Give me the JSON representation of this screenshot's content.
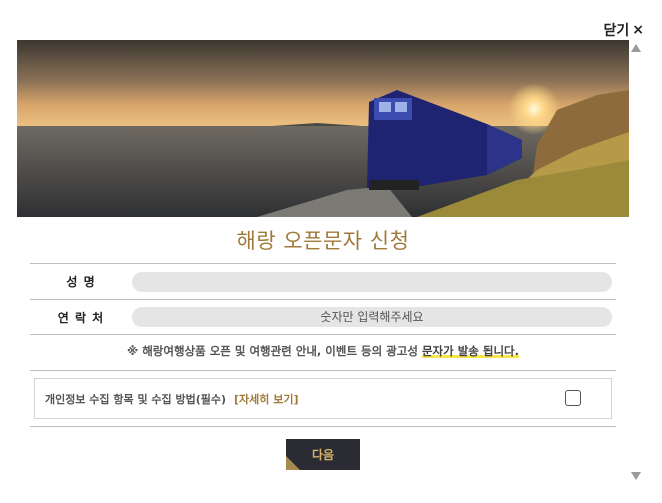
{
  "close": {
    "label": "닫기",
    "icon": "×"
  },
  "title": "해랑 오픈문자 신청",
  "form": {
    "name_label": "성 명",
    "name_value": "",
    "phone_label": "연 락 처",
    "phone_placeholder": "숫자만 입력해주세요"
  },
  "notice": {
    "prefix": "※ 해랑여행상품 오픈 및 여행관련 안내, 이벤트 등의 광고성 ",
    "highlight": "문자가 발송 됩니다."
  },
  "consent": {
    "text": "개인정보 수집 항목 및 수집 방법(필수)",
    "link": "[자세히 보기]",
    "checked": false
  },
  "next_button": "다음",
  "colors": {
    "accent": "#a07a3a",
    "button_bg": "#2b2b33",
    "button_text": "#d6b36a",
    "highlight": "#f7e64a"
  }
}
